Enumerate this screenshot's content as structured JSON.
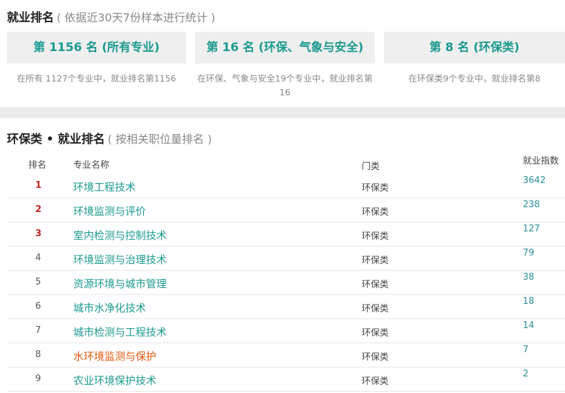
{
  "section1": {
    "title": "就业排名",
    "subtitle": "( 依据近30天7份样本进行统计 )",
    "cards": [
      {
        "label": "第 1156 名 (所有专业)",
        "desc": "在所有 1127个专业中，就业排名第1156"
      },
      {
        "label": "第 16 名 (环保、气象与安全)",
        "desc": "在环保、气象与安全19个专业中，就业排名第16"
      },
      {
        "label": "第 8 名 (环保类)",
        "desc": "在环保类9个专业中，就业排名第8"
      }
    ]
  },
  "section2": {
    "title": "环保类 • 就业排名",
    "subtitle": "( 按相关职位量排名 )",
    "headers": {
      "rank": "排名",
      "name": "专业名称",
      "category": "门类",
      "index": "就业指数"
    },
    "rows": [
      {
        "rank": "1",
        "name": "环境工程技术",
        "category": "环保类",
        "index": "3642"
      },
      {
        "rank": "2",
        "name": "环境监测与评价",
        "category": "环保类",
        "index": "238"
      },
      {
        "rank": "3",
        "name": "室内检测与控制技术",
        "category": "环保类",
        "index": "127"
      },
      {
        "rank": "4",
        "name": "环境监测与治理技术",
        "category": "环保类",
        "index": "79"
      },
      {
        "rank": "5",
        "name": "资源环境与城市管理",
        "category": "环保类",
        "index": "38"
      },
      {
        "rank": "6",
        "name": "城市水净化技术",
        "category": "环保类",
        "index": "18"
      },
      {
        "rank": "7",
        "name": "城市检测与工程技术",
        "category": "环保类",
        "index": "14"
      },
      {
        "rank": "8",
        "name": "水环境监测与保护",
        "category": "环保类",
        "index": "7"
      },
      {
        "rank": "9",
        "name": "农业环境保护技术",
        "category": "环保类",
        "index": "2"
      }
    ]
  },
  "colors": {
    "accent": "#1a9a8e",
    "top_rank": "#c0251e",
    "highlight": "#e4570e"
  }
}
